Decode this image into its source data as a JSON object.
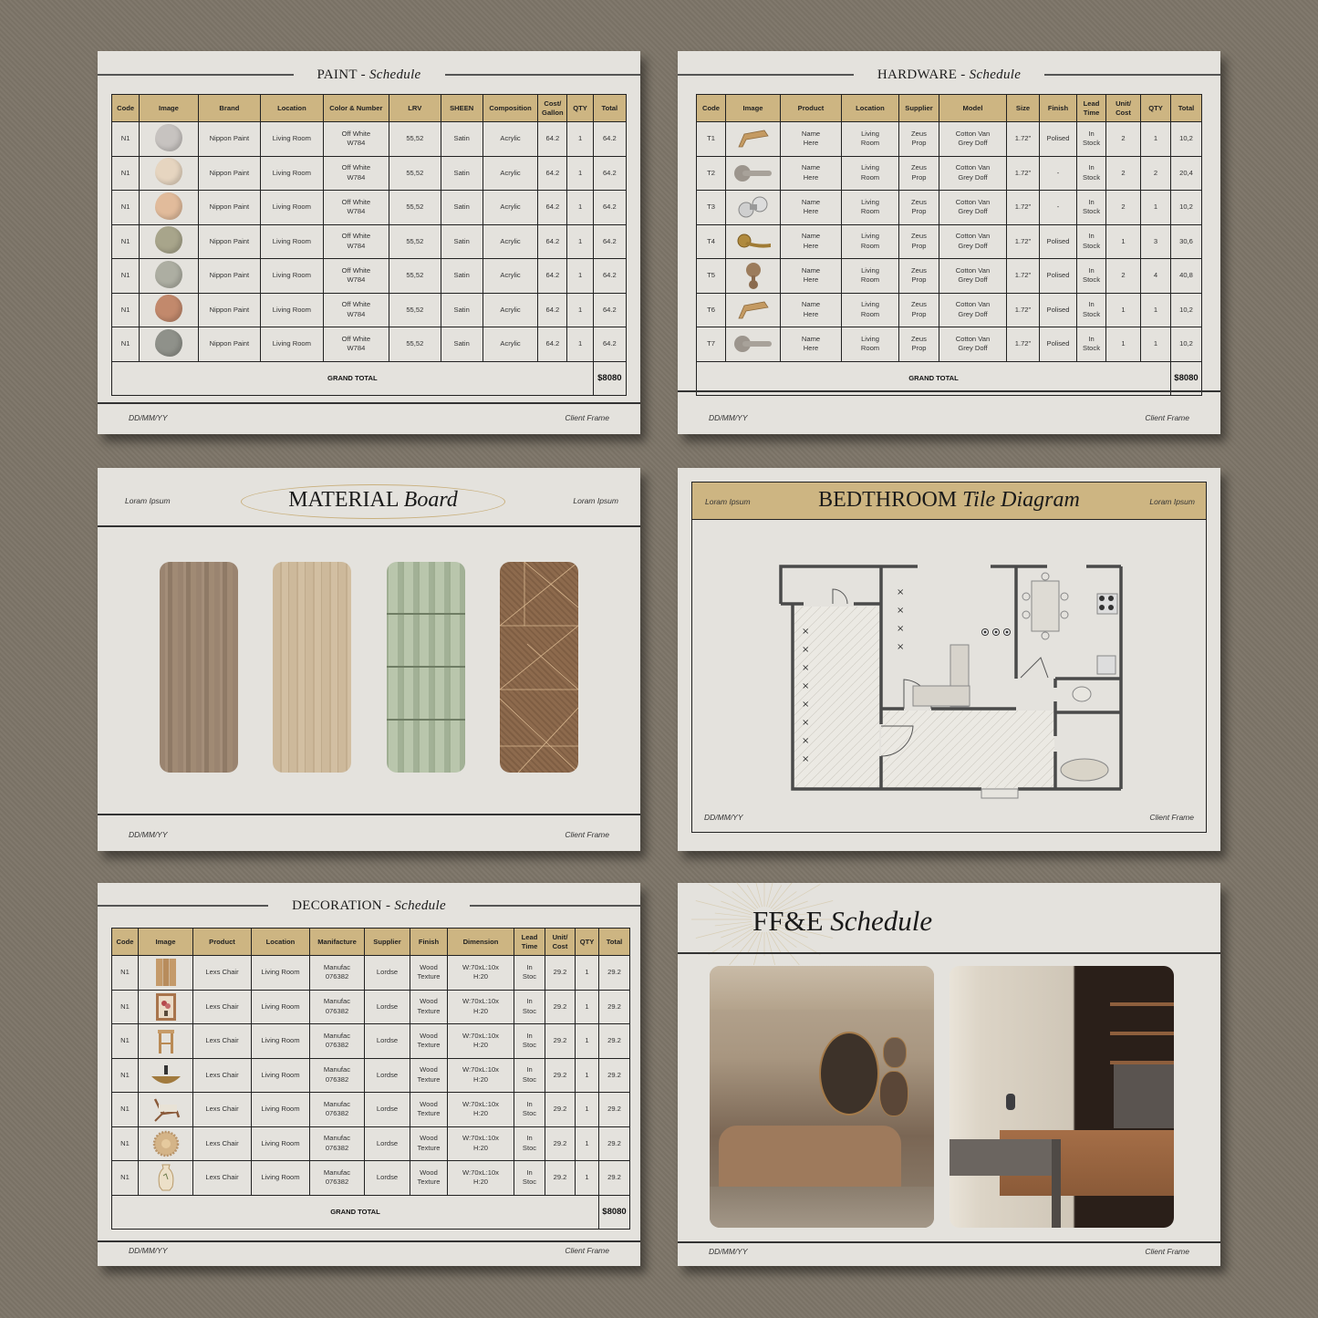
{
  "paint": {
    "title_main": "PAINT",
    "title_sep": " - ",
    "title_italic": "Schedule",
    "headers": [
      "Code",
      "Image",
      "Brand",
      "Location",
      "Color & Number",
      "LRV",
      "SHEEN",
      "Composition",
      "Cost/ Gallon",
      "QTY",
      "Total"
    ],
    "rows": [
      {
        "code": "N1",
        "swatch": "#c7c3c0",
        "brand": "Nippon Paint",
        "location": "Living Room",
        "color_line1": "Off White",
        "color_line2": "W784",
        "lrv": "55,52",
        "sheen": "Satin",
        "composition": "Acrylic",
        "cost": "64.2",
        "qty": "1",
        "total": "64.2"
      },
      {
        "code": "N1",
        "swatch": "#e6d5c0",
        "brand": "Nippon Paint",
        "location": "Living Room",
        "color_line1": "Off White",
        "color_line2": "W784",
        "lrv": "55,52",
        "sheen": "Satin",
        "composition": "Acrylic",
        "cost": "64.2",
        "qty": "1",
        "total": "64.2"
      },
      {
        "code": "N1",
        "swatch": "#e1bb9b",
        "brand": "Nippon Paint",
        "location": "Living Room",
        "color_line1": "Off White",
        "color_line2": "W784",
        "lrv": "55,52",
        "sheen": "Satin",
        "composition": "Acrylic",
        "cost": "64.2",
        "qty": "1",
        "total": "64.2"
      },
      {
        "code": "N1",
        "swatch": "#a8a58b",
        "brand": "Nippon Paint",
        "location": "Living Room",
        "color_line1": "Off White",
        "color_line2": "W784",
        "lrv": "55,52",
        "sheen": "Satin",
        "composition": "Acrylic",
        "cost": "64.2",
        "qty": "1",
        "total": "64.2"
      },
      {
        "code": "N1",
        "swatch": "#adaea2",
        "brand": "Nippon Paint",
        "location": "Living Room",
        "color_line1": "Off White",
        "color_line2": "W784",
        "lrv": "55,52",
        "sheen": "Satin",
        "composition": "Acrylic",
        "cost": "64.2",
        "qty": "1",
        "total": "64.2"
      },
      {
        "code": "N1",
        "swatch": "#c2896c",
        "brand": "Nippon Paint",
        "location": "Living Room",
        "color_line1": "Off White",
        "color_line2": "W784",
        "lrv": "55,52",
        "sheen": "Satin",
        "composition": "Acrylic",
        "cost": "64.2",
        "qty": "1",
        "total": "64.2"
      },
      {
        "code": "N1",
        "swatch": "#8f918a",
        "brand": "Nippon Paint",
        "location": "Living Room",
        "color_line1": "Off White",
        "color_line2": "W784",
        "lrv": "55,52",
        "sheen": "Satin",
        "composition": "Acrylic",
        "cost": "64.2",
        "qty": "1",
        "total": "64.2"
      }
    ],
    "grand_total_label": "GRAND TOTAL",
    "grand_total_value": "$8080",
    "footer_date": "DD/MM/YY",
    "footer_client": "Client Frame"
  },
  "hardware": {
    "title_main": "HARDWARE",
    "title_sep": " - ",
    "title_italic": "Schedule",
    "headers": [
      "Code",
      "Image",
      "Product",
      "Location",
      "Supplier",
      "Model",
      "Size",
      "Finish",
      "Lead Time",
      "Unit/ Cost",
      "QTY",
      "Total"
    ],
    "rows": [
      {
        "code": "T1",
        "icon": "cabinet-pull-brass",
        "product_line1": "Name",
        "product_line2": "Here",
        "loc1": "Living",
        "loc2": "Room",
        "sup1": "Zeus",
        "sup2": "Prop",
        "model1": "Cotton Van",
        "model2": "Grey Doff",
        "size": "1.72\"",
        "finish": "Polised",
        "lead1": "In",
        "lead2": "Stock",
        "unit": "2",
        "qty": "1",
        "total": "10,2"
      },
      {
        "code": "T2",
        "icon": "lever-handle-nickel",
        "product_line1": "Name",
        "product_line2": "Here",
        "loc1": "Living",
        "loc2": "Room",
        "sup1": "Zeus",
        "sup2": "Prop",
        "model1": "Cotton Van",
        "model2": "Grey Doff",
        "size": "1.72\"",
        "finish": "-",
        "lead1": "In",
        "lead2": "Stock",
        "unit": "2",
        "qty": "2",
        "total": "20,4"
      },
      {
        "code": "T3",
        "icon": "door-knob-chrome",
        "product_line1": "Name",
        "product_line2": "Here",
        "loc1": "Living",
        "loc2": "Room",
        "sup1": "Zeus",
        "sup2": "Prop",
        "model1": "Cotton Van",
        "model2": "Grey Doff",
        "size": "1.72\"",
        "finish": "-",
        "lead1": "In",
        "lead2": "Stock",
        "unit": "2",
        "qty": "1",
        "total": "10,2"
      },
      {
        "code": "T4",
        "icon": "lever-handle-brass",
        "product_line1": "Name",
        "product_line2": "Here",
        "loc1": "Living",
        "loc2": "Room",
        "sup1": "Zeus",
        "sup2": "Prop",
        "model1": "Cotton Van",
        "model2": "Grey Doff",
        "size": "1.72\"",
        "finish": "Polised",
        "lead1": "In",
        "lead2": "Stock",
        "unit": "1",
        "qty": "3",
        "total": "30,6"
      },
      {
        "code": "T5",
        "icon": "cabinet-knob-bronze",
        "product_line1": "Name",
        "product_line2": "Here",
        "loc1": "Living",
        "loc2": "Room",
        "sup1": "Zeus",
        "sup2": "Prop",
        "model1": "Cotton Van",
        "model2": "Grey Doff",
        "size": "1.72\"",
        "finish": "Polised",
        "lead1": "In",
        "lead2": "Stock",
        "unit": "2",
        "qty": "4",
        "total": "40,8"
      },
      {
        "code": "T6",
        "icon": "cabinet-pull-brass",
        "product_line1": "Name",
        "product_line2": "Here",
        "loc1": "Living",
        "loc2": "Room",
        "sup1": "Zeus",
        "sup2": "Prop",
        "model1": "Cotton Van",
        "model2": "Grey Doff",
        "size": "1.72\"",
        "finish": "Polised",
        "lead1": "In",
        "lead2": "Stock",
        "unit": "1",
        "qty": "1",
        "total": "10,2"
      },
      {
        "code": "T7",
        "icon": "lever-handle-nickel",
        "product_line1": "Name",
        "product_line2": "Here",
        "loc1": "Living",
        "loc2": "Room",
        "sup1": "Zeus",
        "sup2": "Prop",
        "model1": "Cotton Van",
        "model2": "Grey Doff",
        "size": "1.72\"",
        "finish": "Polised",
        "lead1": "In",
        "lead2": "Stock",
        "unit": "1",
        "qty": "1",
        "total": "10,2"
      }
    ],
    "grand_total_label": "GRAND TOTAL",
    "grand_total_value": "$8080",
    "footer_date": "DD/MM/YY",
    "footer_client": "Client Frame"
  },
  "material": {
    "title_main": "MATERIAL",
    "title_italic": "Board",
    "left_note": "Loram Ipsum",
    "right_note": "Loram Ipsum",
    "swatches": [
      {
        "name": "oak-wood-plank",
        "color": "#9b8570"
      },
      {
        "name": "light-oak-parquet",
        "color": "#c9b597"
      },
      {
        "name": "sage-green-tile",
        "color": "#a9b79c"
      },
      {
        "name": "walnut-geometric-veneer",
        "color": "#8f6c4f"
      }
    ],
    "footer_date": "DD/MM/YY",
    "footer_client": "Client Frame"
  },
  "tile": {
    "title_main": "BEDTHROOM",
    "title_italic": "Tile Diagram",
    "left_note": "Loram Ipsum",
    "right_note": "Loram Ipsum",
    "footer_date": "DD/MM/YY",
    "footer_client": "Client Frame"
  },
  "decoration": {
    "title_main": "DECORATION",
    "title_sep": " - ",
    "title_italic": "Schedule",
    "headers": [
      "Code",
      "Image",
      "Product",
      "Location",
      "Manifacture",
      "Supplier",
      "Finish",
      "Dimension",
      "Lead Time",
      "Unit/ Cost",
      "QTY",
      "Total"
    ],
    "rows": [
      {
        "code": "N1",
        "icon": "folding-screen",
        "product": "Lexs Chair",
        "location": "Living Room",
        "man1": "Manufac",
        "man2": "076382",
        "supplier": "Lordse",
        "fin1": "Wood",
        "fin2": "Texture",
        "dim1": "W:70xL:10x",
        "dim2": "H:20",
        "lead1": "In",
        "lead2": "Stoc",
        "unit": "29.2",
        "qty": "1",
        "total": "29.2"
      },
      {
        "code": "N1",
        "icon": "framed-flower-painting",
        "product": "Lexs Chair",
        "location": "Living Room",
        "man1": "Manufac",
        "man2": "076382",
        "supplier": "Lordse",
        "fin1": "Wood",
        "fin2": "Texture",
        "dim1": "W:70xL:10x",
        "dim2": "H:20",
        "lead1": "In",
        "lead2": "Stoc",
        "unit": "29.2",
        "qty": "1",
        "total": "29.2"
      },
      {
        "code": "N1",
        "icon": "wooden-stool",
        "product": "Lexs Chair",
        "location": "Living Room",
        "man1": "Manufac",
        "man2": "076382",
        "supplier": "Lordse",
        "fin1": "Wood",
        "fin2": "Texture",
        "dim1": "W:70xL:10x",
        "dim2": "H:20",
        "lead1": "In",
        "lead2": "Stoc",
        "unit": "29.2",
        "qty": "1",
        "total": "29.2"
      },
      {
        "code": "N1",
        "icon": "vessel-sink-bowl",
        "product": "Lexs Chair",
        "location": "Living Room",
        "man1": "Manufac",
        "man2": "076382",
        "supplier": "Lordse",
        "fin1": "Wood",
        "fin2": "Texture",
        "dim1": "W:70xL:10x",
        "dim2": "H:20",
        "lead1": "In",
        "lead2": "Stoc",
        "unit": "29.2",
        "qty": "1",
        "total": "29.2"
      },
      {
        "code": "N1",
        "icon": "lounge-chair",
        "product": "Lexs Chair",
        "location": "Living Room",
        "man1": "Manufac",
        "man2": "076382",
        "supplier": "Lordse",
        "fin1": "Wood",
        "fin2": "Texture",
        "dim1": "W:70xL:10x",
        "dim2": "H:20",
        "lead1": "In",
        "lead2": "Stoc",
        "unit": "29.2",
        "qty": "1",
        "total": "29.2"
      },
      {
        "code": "N1",
        "icon": "carved-medallion",
        "product": "Lexs Chair",
        "location": "Living Room",
        "man1": "Manufac",
        "man2": "076382",
        "supplier": "Lordse",
        "fin1": "Wood",
        "fin2": "Texture",
        "dim1": "W:70xL:10x",
        "dim2": "H:20",
        "lead1": "In",
        "lead2": "Stoc",
        "unit": "29.2",
        "qty": "1",
        "total": "29.2"
      },
      {
        "code": "N1",
        "icon": "ceramic-vase",
        "product": "Lexs Chair",
        "location": "Living Room",
        "man1": "Manufac",
        "man2": "076382",
        "supplier": "Lordse",
        "fin1": "Wood",
        "fin2": "Texture",
        "dim1": "W:70xL:10x",
        "dim2": "H:20",
        "lead1": "In",
        "lead2": "Stoc",
        "unit": "29.2",
        "qty": "1",
        "total": "29.2"
      }
    ],
    "grand_total_label": "GRAND TOTAL",
    "grand_total_value": "$8080",
    "footer_date": "DD/MM/YY",
    "footer_client": "Client Frame"
  },
  "ffe": {
    "title_main": "FF&E",
    "title_italic": "Schedule",
    "photos": [
      {
        "name": "dining-room-photo"
      },
      {
        "name": "kitchen-photo"
      }
    ],
    "footer_date": "DD/MM/YY",
    "footer_client": "Client Frame"
  },
  "colors": {
    "accent_gold": "#cdb582",
    "page_bg": "#e4e2dd",
    "backdrop": "#7d7568"
  }
}
